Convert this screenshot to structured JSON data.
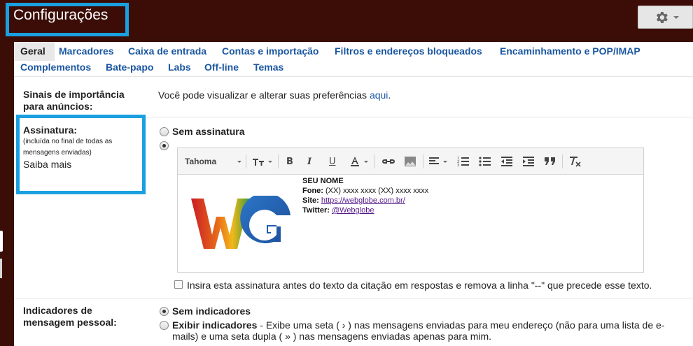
{
  "header": {
    "title": "Configurações"
  },
  "tabs": [
    {
      "label": "Geral",
      "active": true
    },
    {
      "label": "Marcadores"
    },
    {
      "label": "Caixa de entrada"
    },
    {
      "label": "Contas e importação"
    },
    {
      "label": "Filtros e endereços bloqueados"
    },
    {
      "label": "Encaminhamento e POP/IMAP"
    },
    {
      "label": "Complementos"
    },
    {
      "label": "Bate-papo"
    },
    {
      "label": "Labs"
    },
    {
      "label": "Off-line"
    },
    {
      "label": "Temas"
    }
  ],
  "importance": {
    "label_line1": "Sinais de importância",
    "label_line2": "para anúncios:",
    "description": "Você pode visualizar e alterar suas preferências ",
    "link": "aqui",
    "link_suffix": "."
  },
  "signature": {
    "label": "Assinatura:",
    "sub_line1": "(incluída no final de todas as",
    "sub_line2": "mensagens enviadas)",
    "learn_more": "Saiba mais",
    "no_signature": "Sem assinatura",
    "font": "Tahoma",
    "logo_text": "WG",
    "lines": {
      "name": "SEU NOME",
      "phone_label": "Fone:",
      "phone_value": " (XX) xxxx xxxx (XX) xxxx xxxx",
      "site_label": "Site:",
      "site_value": "https://webglobe.com.br/",
      "twitter_label": "Twitter:",
      "twitter_value": "@Webglobe"
    },
    "insert_before_quote": "Insira esta assinatura antes do texto da citação em respostas e remova a linha \"--\" que precede esse texto."
  },
  "indicators": {
    "label_line1": "Indicadores de",
    "label_line2": "mensagem pessoal:",
    "none": "Sem indicadores",
    "show": "Exibir indicadores",
    "show_desc_line1": " - Exibe uma seta ( › ) nas mensagens enviadas para meu endereço (não para uma lista de e-",
    "show_desc_line2": "mails) e uma seta dupla ( » ) nas mensagens enviadas apenas para mim."
  },
  "colors": {
    "header_bg": "#3b0d06",
    "highlight_border": "#1aa0e0",
    "link": "#1a56a0"
  }
}
